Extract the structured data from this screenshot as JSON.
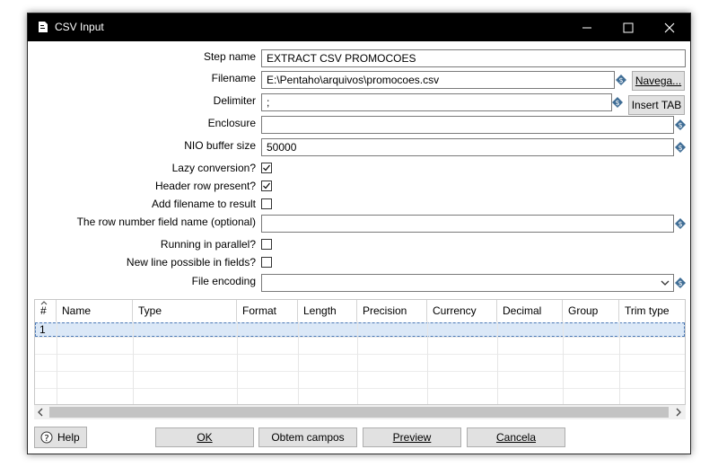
{
  "window": {
    "title": "CSV Input"
  },
  "form": {
    "step_name_label": "Step name",
    "step_name_value": "EXTRACT CSV PROMOCOES",
    "filename_label": "Filename",
    "filename_value": "E:\\Pentaho\\arquivos\\promocoes.csv",
    "browse_button": "Navega...",
    "delimiter_label": "Delimiter",
    "delimiter_value": ";",
    "insert_tab_button": "Insert TAB",
    "enclosure_label": "Enclosure",
    "enclosure_value": "",
    "nio_label": "NIO buffer size",
    "nio_value": "50000",
    "lazy_label": "Lazy conversion?",
    "lazy_checked": true,
    "header_label": "Header row present?",
    "header_checked": true,
    "addfile_label": "Add filename to result",
    "addfile_checked": false,
    "rownum_label": "The row number field name (optional)",
    "rownum_value": "",
    "parallel_label": "Running in parallel?",
    "parallel_checked": false,
    "newline_label": "New line possible in fields?",
    "newline_checked": false,
    "encoding_label": "File encoding",
    "encoding_value": ""
  },
  "table": {
    "headers": [
      "#",
      "Name",
      "Type",
      "Format",
      "Length",
      "Precision",
      "Currency",
      "Decimal",
      "Group",
      "Trim type"
    ],
    "rows": [
      [
        "1",
        "",
        "",
        "",
        "",
        "",
        "",
        "",
        "",
        ""
      ]
    ]
  },
  "footer": {
    "help": "Help",
    "ok": "OK",
    "get_fields": "Obtem campos",
    "preview": "Preview",
    "cancel": "Cancela"
  }
}
